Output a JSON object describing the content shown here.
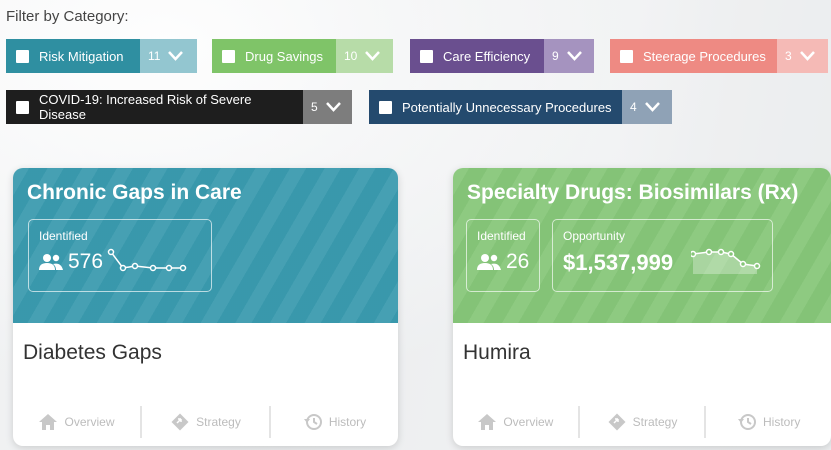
{
  "filter": {
    "title": "Filter by Category:",
    "chips": [
      {
        "label": "Risk Mitigation",
        "count": "11",
        "color": "#2f8fa1",
        "side_color": "#93c6d0"
      },
      {
        "label": "Drug Savings",
        "count": "10",
        "color": "#7fc468",
        "side_color": "#b7dca8"
      },
      {
        "label": "Care Efficiency",
        "count": "9",
        "color": "#6a4f8f",
        "side_color": "#a593bf"
      },
      {
        "label": "Steerage Procedures",
        "count": "3",
        "color": "#ee8a83",
        "side_color": "#f5bab6"
      },
      {
        "label": "COVID-19: Increased Risk of Severe Disease",
        "count": "5",
        "color": "#1e1e1e",
        "side_color": "#7d7d7d"
      },
      {
        "label": "Potentially Unnecessary Procedures",
        "count": "4",
        "color": "#244a6e",
        "side_color": "#8fa2b6"
      }
    ]
  },
  "cards": [
    {
      "title": "Chronic Gaps in Care",
      "color": "#3a9aae",
      "identified_label": "Identified",
      "identified_value": "576",
      "name": "Diabetes Gaps",
      "actions": [
        "Overview",
        "Strategy",
        "History"
      ]
    },
    {
      "title": "Specialty Drugs: Biosimilars (Rx)",
      "color": "#86c679",
      "identified_label": "Identified",
      "identified_value": "26",
      "opportunity_label": "Opportunity",
      "opportunity_value": "$1,537,999",
      "name": "Humira",
      "actions": [
        "Overview",
        "Strategy",
        "History"
      ]
    }
  ]
}
